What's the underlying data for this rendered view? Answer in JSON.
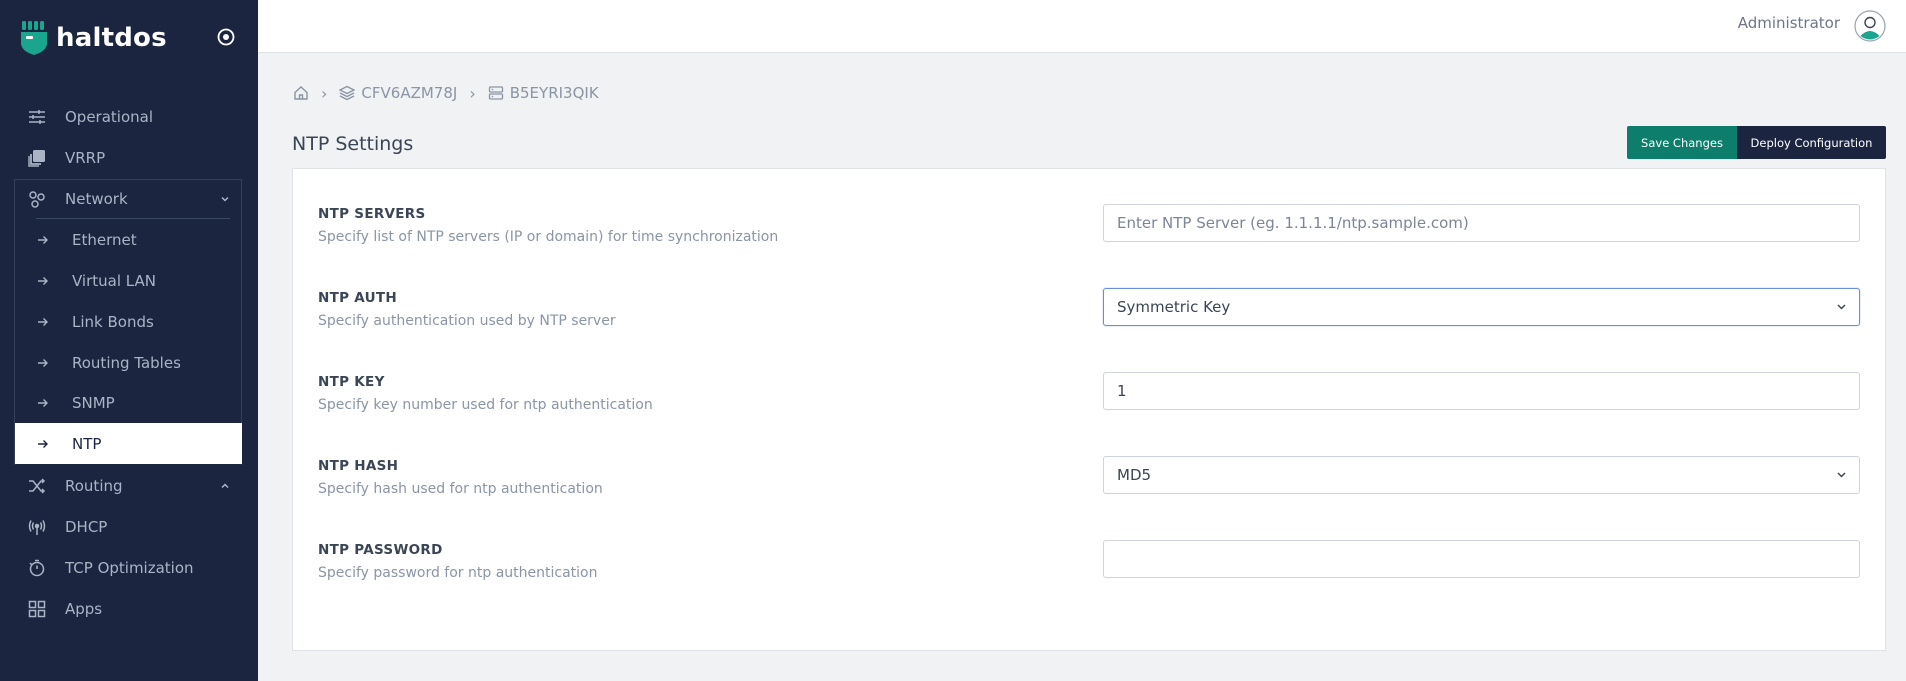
{
  "brand": {
    "name": "haltdos"
  },
  "sidebar": {
    "items": [
      {
        "label": "Operational",
        "icon": "sliders-icon"
      },
      {
        "label": "VRRP",
        "icon": "copy-icon"
      },
      {
        "label": "Network",
        "icon": "network-icon",
        "expanded": true
      },
      {
        "label": "Routing",
        "icon": "shuffle-icon",
        "expanded": false
      },
      {
        "label": "DHCP",
        "icon": "antenna-icon"
      },
      {
        "label": "TCP Optimization",
        "icon": "stopwatch-icon"
      },
      {
        "label": "Apps",
        "icon": "grid-icon"
      }
    ],
    "network_sub_items": [
      {
        "label": "Ethernet"
      },
      {
        "label": "Virtual LAN"
      },
      {
        "label": "Link Bonds"
      },
      {
        "label": "Routing Tables"
      },
      {
        "label": "SNMP"
      },
      {
        "label": "NTP",
        "active": true
      }
    ]
  },
  "header": {
    "user_name": "Administrator"
  },
  "breadcrumb": {
    "items": [
      "CFV6AZM78J",
      "B5EYRI3QIK"
    ]
  },
  "page": {
    "title": "NTP Settings",
    "save_label": "Save Changes",
    "deploy_label": "Deploy Configuration"
  },
  "form": {
    "fields": [
      {
        "label": "NTP SERVERS",
        "description": "Specify list of NTP servers (IP or domain) for time synchronization",
        "value": "",
        "placeholder": "Enter NTP Server (eg. 1.1.1.1/ntp.sample.com)",
        "type": "text"
      },
      {
        "label": "NTP AUTH",
        "description": "Specify authentication used by NTP server",
        "value": "Symmetric Key",
        "type": "select"
      },
      {
        "label": "NTP KEY",
        "description": "Specify key number used for ntp authentication",
        "value": "1",
        "type": "text"
      },
      {
        "label": "NTP HASH",
        "description": "Specify hash used for ntp authentication",
        "value": "MD5",
        "type": "select"
      },
      {
        "label": "NTP PASSWORD",
        "description": "Specify password for ntp authentication",
        "value": "",
        "type": "password"
      }
    ]
  },
  "colors": {
    "sidebar_bg": "#1b2540",
    "primary": "#0c7e6b",
    "dark": "#1b2540",
    "logo_accent": "#1aa58f"
  }
}
